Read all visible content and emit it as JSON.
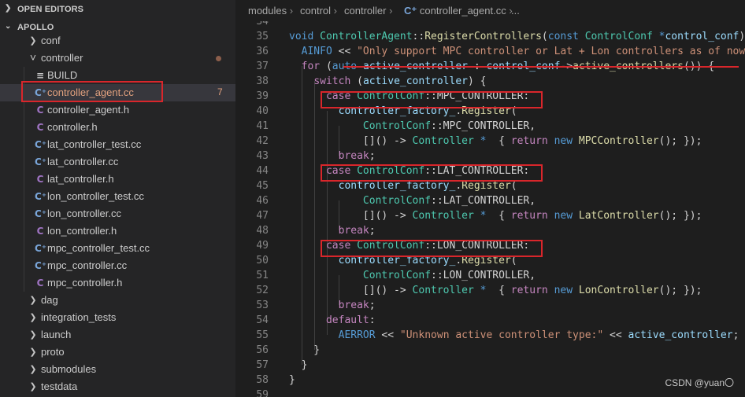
{
  "sidebar": {
    "open_editors": "OPEN EDITORS",
    "workspace": "APOLLO",
    "items": [
      {
        "label": "conf",
        "kind": "folder",
        "expanded": false,
        "depth": 1
      },
      {
        "label": "controller",
        "kind": "folder",
        "expanded": true,
        "depth": 1,
        "modified": true
      },
      {
        "label": "BUILD",
        "kind": "build",
        "depth": 2
      },
      {
        "label": "controller_agent.cc",
        "kind": "cc",
        "depth": 2,
        "selected": true,
        "badge": "7"
      },
      {
        "label": "controller_agent.h",
        "kind": "h",
        "depth": 2
      },
      {
        "label": "controller.h",
        "kind": "h",
        "depth": 2
      },
      {
        "label": "lat_controller_test.cc",
        "kind": "cc",
        "depth": 2
      },
      {
        "label": "lat_controller.cc",
        "kind": "cc",
        "depth": 2
      },
      {
        "label": "lat_controller.h",
        "kind": "h",
        "depth": 2
      },
      {
        "label": "lon_controller_test.cc",
        "kind": "cc",
        "depth": 2
      },
      {
        "label": "lon_controller.cc",
        "kind": "cc",
        "depth": 2
      },
      {
        "label": "lon_controller.h",
        "kind": "h",
        "depth": 2
      },
      {
        "label": "mpc_controller_test.cc",
        "kind": "cc",
        "depth": 2
      },
      {
        "label": "mpc_controller.cc",
        "kind": "cc",
        "depth": 2
      },
      {
        "label": "mpc_controller.h",
        "kind": "h",
        "depth": 2
      },
      {
        "label": "dag",
        "kind": "folder",
        "expanded": false,
        "depth": 1
      },
      {
        "label": "integration_tests",
        "kind": "folder",
        "expanded": false,
        "depth": 1
      },
      {
        "label": "launch",
        "kind": "folder",
        "expanded": false,
        "depth": 1
      },
      {
        "label": "proto",
        "kind": "folder",
        "expanded": false,
        "depth": 1
      },
      {
        "label": "submodules",
        "kind": "folder",
        "expanded": false,
        "depth": 1
      },
      {
        "label": "testdata",
        "kind": "folder",
        "expanded": false,
        "depth": 1
      }
    ]
  },
  "breadcrumb": {
    "parts": [
      "modules",
      "control",
      "controller",
      "controller_agent.cc",
      "..."
    ]
  },
  "editor": {
    "lines": [
      {
        "n": "34",
        "tokens": []
      },
      {
        "n": "35",
        "tokens": [
          [
            "kw",
            "void "
          ],
          [
            "ty",
            "ControllerAgent"
          ],
          [
            "",
            "::"
          ],
          [
            "fn",
            "RegisterControllers"
          ],
          [
            "",
            "("
          ],
          [
            "kw",
            "const "
          ],
          [
            "ty",
            "ControlConf "
          ],
          [
            "kw",
            "*"
          ],
          [
            "var",
            "control_conf"
          ],
          [
            "",
            ")"
          ]
        ]
      },
      {
        "n": "36",
        "tokens": [
          [
            "",
            "  "
          ],
          [
            "mac",
            "AINFO"
          ],
          [
            "",
            " << "
          ],
          [
            "str",
            "\"Only support MPC controller or Lat + Lon controllers as of now\""
          ],
          [
            "",
            ";"
          ]
        ]
      },
      {
        "n": "37",
        "tokens": [
          [
            "",
            "  "
          ],
          [
            "ctl",
            "for"
          ],
          [
            "",
            " ("
          ],
          [
            "kw",
            "auto "
          ],
          [
            "var",
            "active_controller"
          ],
          [
            "",
            " : "
          ],
          [
            "var",
            "control_conf"
          ],
          [
            "",
            "->"
          ],
          [
            "fn",
            "active_controllers"
          ],
          [
            "",
            "()) {"
          ]
        ]
      },
      {
        "n": "38",
        "tokens": [
          [
            "",
            "    "
          ],
          [
            "ctl",
            "switch"
          ],
          [
            "",
            " ("
          ],
          [
            "var",
            "active_controller"
          ],
          [
            "",
            ") {"
          ]
        ]
      },
      {
        "n": "39",
        "tokens": [
          [
            "",
            "      "
          ],
          [
            "ctl",
            "case "
          ],
          [
            "ty",
            "ControlConf"
          ],
          [
            "",
            "::MPC_CONTROLLER:"
          ]
        ]
      },
      {
        "n": "40",
        "tokens": [
          [
            "",
            "        "
          ],
          [
            "var",
            "controller_factory_"
          ],
          [
            "",
            "."
          ],
          [
            "fn",
            "Register"
          ],
          [
            "",
            "("
          ]
        ]
      },
      {
        "n": "41",
        "tokens": [
          [
            "",
            "            "
          ],
          [
            "ty",
            "ControlConf"
          ],
          [
            "",
            "::MPC_CONTROLLER,"
          ]
        ]
      },
      {
        "n": "42",
        "tokens": [
          [
            "",
            "            []() -> "
          ],
          [
            "ty",
            "Controller "
          ],
          [
            "kw",
            "* "
          ],
          [
            "",
            " { "
          ],
          [
            "ctl",
            "return "
          ],
          [
            "kw",
            "new "
          ],
          [
            "fn",
            "MPCController"
          ],
          [
            "",
            "(); });"
          ]
        ]
      },
      {
        "n": "43",
        "tokens": [
          [
            "",
            "        "
          ],
          [
            "ctl",
            "break"
          ],
          [
            "",
            ";"
          ]
        ]
      },
      {
        "n": "44",
        "tokens": [
          [
            "",
            "      "
          ],
          [
            "ctl",
            "case "
          ],
          [
            "ty",
            "ControlConf"
          ],
          [
            "",
            "::LAT_CONTROLLER:"
          ]
        ]
      },
      {
        "n": "45",
        "tokens": [
          [
            "",
            "        "
          ],
          [
            "var",
            "controller_factory_"
          ],
          [
            "",
            "."
          ],
          [
            "fn",
            "Register"
          ],
          [
            "",
            "("
          ]
        ]
      },
      {
        "n": "46",
        "tokens": [
          [
            "",
            "            "
          ],
          [
            "ty",
            "ControlConf"
          ],
          [
            "",
            "::LAT_CONTROLLER,"
          ]
        ]
      },
      {
        "n": "47",
        "tokens": [
          [
            "",
            "            []() -> "
          ],
          [
            "ty",
            "Controller "
          ],
          [
            "kw",
            "* "
          ],
          [
            "",
            " { "
          ],
          [
            "ctl",
            "return "
          ],
          [
            "kw",
            "new "
          ],
          [
            "fn",
            "LatController"
          ],
          [
            "",
            "(); });"
          ]
        ]
      },
      {
        "n": "48",
        "tokens": [
          [
            "",
            "        "
          ],
          [
            "ctl",
            "break"
          ],
          [
            "",
            ";"
          ]
        ]
      },
      {
        "n": "49",
        "tokens": [
          [
            "",
            "      "
          ],
          [
            "ctl",
            "case "
          ],
          [
            "ty",
            "ControlConf"
          ],
          [
            "",
            "::LON_CONTROLLER:"
          ]
        ]
      },
      {
        "n": "50",
        "tokens": [
          [
            "",
            "        "
          ],
          [
            "var",
            "controller_factory_"
          ],
          [
            "",
            "."
          ],
          [
            "fn",
            "Register"
          ],
          [
            "",
            "("
          ]
        ]
      },
      {
        "n": "51",
        "tokens": [
          [
            "",
            "            "
          ],
          [
            "ty",
            "ControlConf"
          ],
          [
            "",
            "::LON_CONTROLLER,"
          ]
        ]
      },
      {
        "n": "52",
        "tokens": [
          [
            "",
            "            []() -> "
          ],
          [
            "ty",
            "Controller "
          ],
          [
            "kw",
            "* "
          ],
          [
            "",
            " { "
          ],
          [
            "ctl",
            "return "
          ],
          [
            "kw",
            "new "
          ],
          [
            "fn",
            "LonController"
          ],
          [
            "",
            "(); });"
          ]
        ]
      },
      {
        "n": "53",
        "tokens": [
          [
            "",
            "        "
          ],
          [
            "ctl",
            "break"
          ],
          [
            "",
            ";"
          ]
        ]
      },
      {
        "n": "54",
        "tokens": [
          [
            "",
            "      "
          ],
          [
            "ctl",
            "default"
          ],
          [
            "",
            ":"
          ]
        ]
      },
      {
        "n": "55",
        "tokens": [
          [
            "",
            "        "
          ],
          [
            "mac",
            "AERROR"
          ],
          [
            "",
            " << "
          ],
          [
            "str",
            "\"Unknown active controller type:\""
          ],
          [
            "",
            " << "
          ],
          [
            "var",
            "active_controller"
          ],
          [
            "",
            ";"
          ]
        ]
      },
      {
        "n": "56",
        "tokens": [
          [
            "",
            "    }"
          ]
        ]
      },
      {
        "n": "57",
        "tokens": [
          [
            "",
            "  }"
          ]
        ]
      },
      {
        "n": "58",
        "tokens": [
          [
            "",
            "}"
          ]
        ]
      },
      {
        "n": "59",
        "tokens": []
      }
    ]
  },
  "watermark": "CSDN @yuan〇",
  "colors": {
    "highlight": "#d9262b",
    "keyword": "#569cd6",
    "control": "#c586c0",
    "function": "#dcdcaa",
    "type": "#4ec9b0",
    "variable": "#9cdcfe",
    "string": "#ce9178"
  }
}
